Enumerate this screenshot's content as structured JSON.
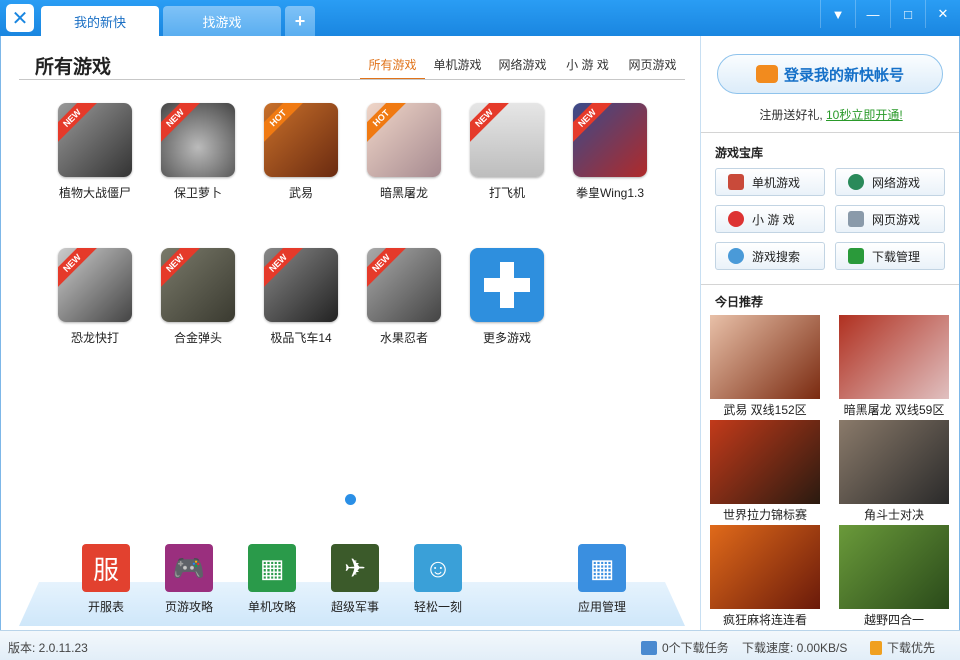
{
  "tabs": [
    {
      "label": "我的新快"
    },
    {
      "label": "找游戏"
    },
    {
      "label": "+"
    }
  ],
  "window_buttons": [
    "▼",
    "—",
    "□",
    "✕"
  ],
  "main": {
    "title": "所有游戏",
    "categories": [
      "所有游戏",
      "单机游戏",
      "网络游戏",
      "小 游 戏",
      "网页游戏"
    ],
    "games": [
      {
        "label": "植物大战僵尸",
        "badge": "NEW"
      },
      {
        "label": "保卫萝卜",
        "badge": "NEW"
      },
      {
        "label": "武易",
        "badge": "HOT"
      },
      {
        "label": "暗黑屠龙",
        "badge": "HOT"
      },
      {
        "label": "打飞机",
        "badge": "NEW"
      },
      {
        "label": "拳皇Wing1.3",
        "badge": "NEW"
      },
      {
        "label": "恐龙快打",
        "badge": "NEW"
      },
      {
        "label": "合金弹头",
        "badge": "NEW"
      },
      {
        "label": "极品飞车14",
        "badge": "NEW"
      },
      {
        "label": "水果忍者",
        "badge": "NEW"
      },
      {
        "label": "更多游戏",
        "badge": ""
      }
    ],
    "tools": [
      {
        "label": "开服表",
        "glyph": "服"
      },
      {
        "label": "页游攻略",
        "glyph": "🎮"
      },
      {
        "label": "单机攻略",
        "glyph": "▦"
      },
      {
        "label": "超级军事",
        "glyph": "✈"
      },
      {
        "label": "轻松一刻",
        "glyph": "☺"
      },
      {
        "label": "应用管理",
        "glyph": "▦"
      }
    ]
  },
  "side": {
    "login_label": "登录我的新快帐号",
    "register_text": "注册送好礼,",
    "register_link": "10秒立即开通!",
    "vault_title": "游戏宝库",
    "vault_buttons": [
      "单机游戏",
      "网络游戏",
      "小 游 戏",
      "网页游戏",
      "游戏搜索",
      "下载管理"
    ],
    "today_title": "今日推荐",
    "recommendations": [
      "武易 双线152区",
      "暗黑屠龙 双线59区",
      "世界拉力锦标赛",
      "角斗士对决",
      "疯狂麻将连连看",
      "越野四合一"
    ]
  },
  "status": {
    "version": "版本: 2.0.11.23",
    "tasks": "0个下载任务",
    "speed": "下载速度:  0.00KB/S",
    "priority": "下载优先"
  }
}
